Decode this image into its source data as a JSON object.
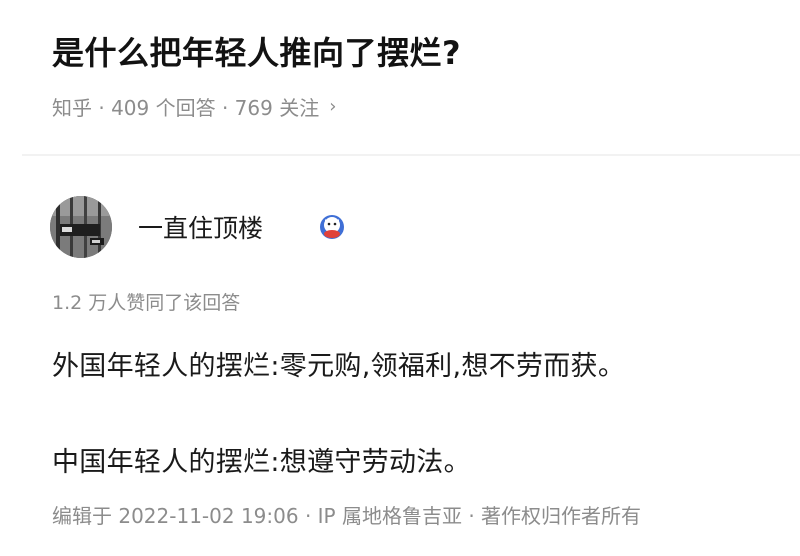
{
  "question": {
    "title": "是什么把年轻人推向了摆烂?",
    "meta": "知乎 · 409 个回答 · 769 关注",
    "chevron": "›"
  },
  "answer": {
    "author_name": "一直住顶楼",
    "badge_icon": "zhihu-mascot-badge-icon",
    "upvotes": "1.2 万人赞同了该回答",
    "paragraphs": [
      "外国年轻人的摆烂:零元购,领福利,想不劳而获。",
      "中国年轻人的摆烂:想遵守劳动法。"
    ],
    "footer": "编辑于 2022-11-02 19:06 · IP 属地格鲁吉亚 · 著作权归作者所有"
  },
  "colors": {
    "title": "#121212",
    "meta": "#8c8c8c",
    "body": "#1a1a1a",
    "divider": "#f2f2f2"
  }
}
